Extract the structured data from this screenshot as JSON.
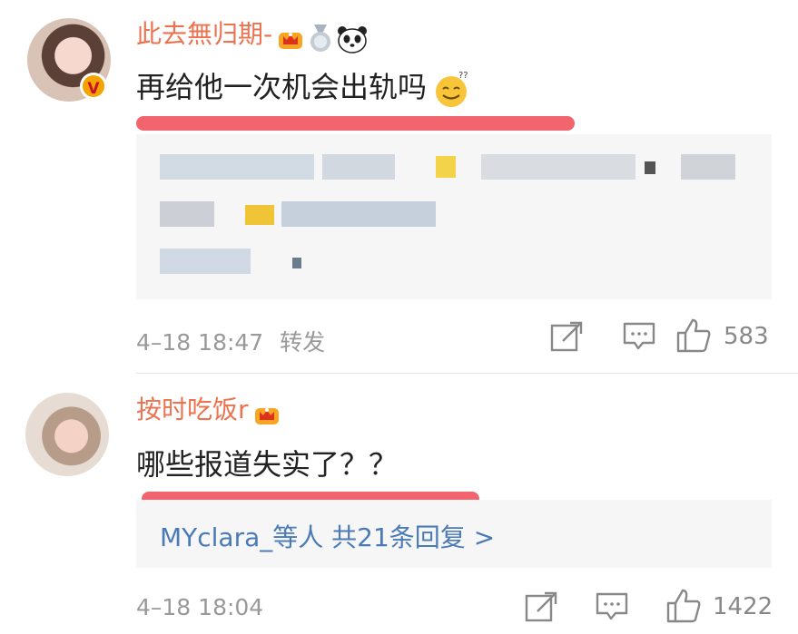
{
  "comments": [
    {
      "username": "此去無归期-",
      "text": "再给他一次机会出轨吗",
      "badges": [
        "crown-badge",
        "medal-badge",
        "panda-emoji"
      ],
      "emoji": "smiling-emoji",
      "verified_badge": "V",
      "time": "4–18 18:47",
      "repost_label": "转发",
      "like_count": "583"
    },
    {
      "username": "按时吃饭r",
      "text": "哪些报道失实了？？",
      "badges": [
        "crown-badge"
      ],
      "time": "4–18 18:04",
      "like_count": "1422",
      "reply_link": "MYclara_等人  共21条回复 >"
    }
  ],
  "colors": {
    "username": "#eb7350",
    "link": "#4a7bb7",
    "highlight": "#f2656e",
    "meta": "#999999"
  }
}
